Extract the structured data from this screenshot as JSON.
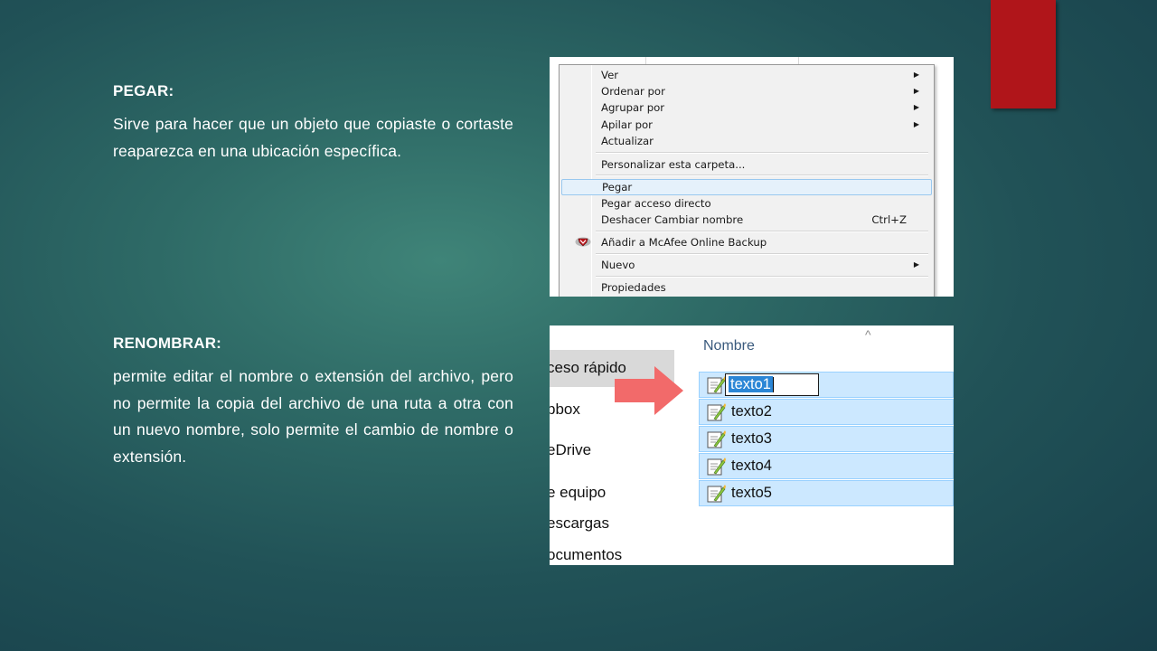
{
  "slide": {
    "accent_color": "#b0151a",
    "sections": [
      {
        "heading": "PEGAR:",
        "body": "Sirve para hacer que un objeto que copiaste o cortaste reaparezca en una ubicación específica."
      },
      {
        "heading": "RENOMBRAR:",
        "body": "permite editar el nombre o extensión del archivo, pero no permite la copia del archivo de una ruta a otra con un nuevo nombre, solo permite el cambio de nombre o extensión."
      }
    ]
  },
  "context_menu": {
    "items": [
      {
        "label": "Ver",
        "submenu": true
      },
      {
        "label": "Ordenar por",
        "submenu": true
      },
      {
        "label": "Agrupar por",
        "submenu": true
      },
      {
        "label": "Apilar por",
        "submenu": true
      },
      {
        "label": "Actualizar"
      },
      {
        "label": "Personalizar esta carpeta..."
      },
      {
        "label": "Pegar",
        "highlighted": true
      },
      {
        "label": "Pegar acceso directo"
      },
      {
        "label": "Deshacer Cambiar nombre",
        "shortcut": "Ctrl+Z"
      },
      {
        "label": "Añadir a McAfee Online Backup",
        "icon": "mcafee-shield-icon"
      },
      {
        "label": "Nuevo",
        "submenu": true
      },
      {
        "label": "Propiedades"
      }
    ],
    "highlight_color": "#e5f1fb"
  },
  "explorer": {
    "nav_items": [
      "ceso rápido",
      "pbox",
      "eDrive",
      "e equipo",
      "escargas",
      "ocumentos"
    ],
    "column_header": "Nombre",
    "rename_value": "texto1",
    "files": [
      "texto2",
      "texto3",
      "texto4",
      "texto5"
    ],
    "selection_color": "#cce8ff",
    "arrow_color": "#f26a6a"
  }
}
